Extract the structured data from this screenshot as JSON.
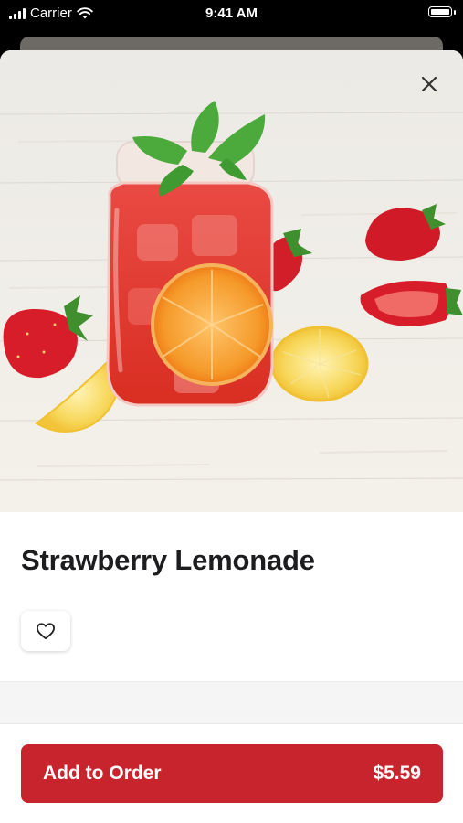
{
  "status_bar": {
    "carrier": "Carrier",
    "time": "9:41 AM"
  },
  "product": {
    "name": "Strawberry Lemonade",
    "image_alt": "strawberry-lemonade-photo"
  },
  "actions": {
    "add_to_order_label": "Add to Order",
    "price": "$5.59"
  },
  "colors": {
    "accent": "#c8242d",
    "title_text": "#1d1d1f"
  },
  "icons": {
    "close": "close-icon",
    "favorite": "heart-outline-icon"
  }
}
